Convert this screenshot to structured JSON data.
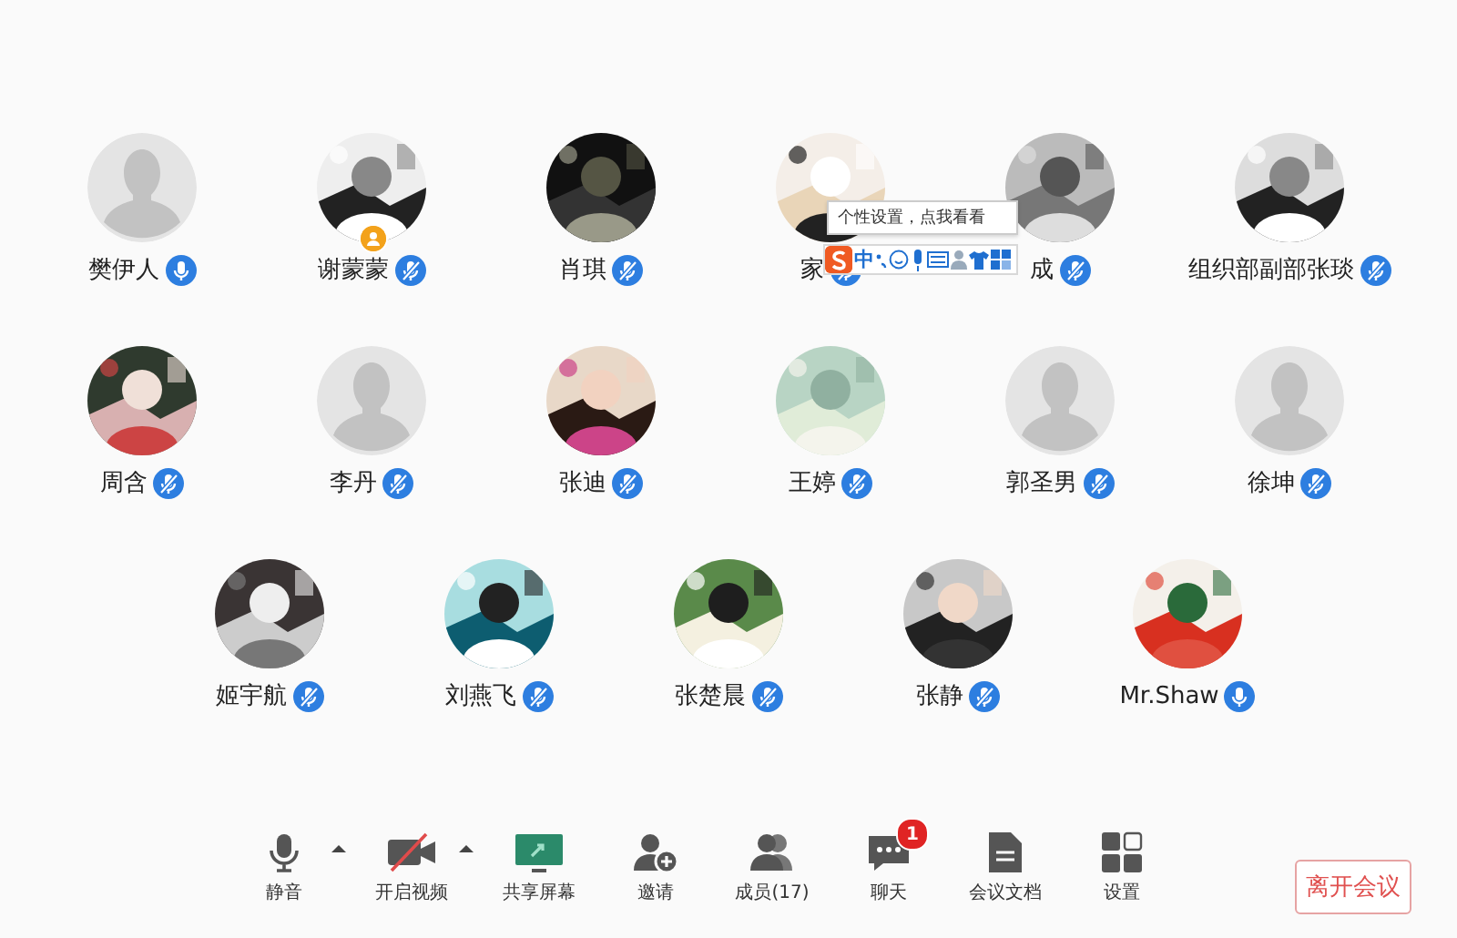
{
  "participants": [
    {
      "name": "樊伊人",
      "kind": "default",
      "muted": false,
      "host": false
    },
    {
      "name": "谢蒙蒙",
      "muted": true,
      "host": true
    },
    {
      "name": "肖琪",
      "muted": true,
      "host": false
    },
    {
      "name": "家",
      "muted": true,
      "host": false
    },
    {
      "name": "成",
      "muted": true,
      "host": false
    },
    {
      "name": "组织部副部张琰",
      "muted": true,
      "host": false
    },
    {
      "name": "周含",
      "muted": true,
      "host": false
    },
    {
      "name": "李丹",
      "kind": "default",
      "muted": true,
      "host": false
    },
    {
      "name": "张迪",
      "muted": true,
      "host": false
    },
    {
      "name": "王婷",
      "muted": true,
      "host": false
    },
    {
      "name": "郭圣男",
      "kind": "default",
      "muted": true,
      "host": false
    },
    {
      "name": "徐坤",
      "kind": "default",
      "muted": true,
      "host": false
    },
    {
      "name": "姬宇航",
      "muted": true,
      "host": false
    },
    {
      "name": "刘燕飞",
      "muted": true,
      "host": false
    },
    {
      "name": "张楚晨",
      "muted": true,
      "host": false
    },
    {
      "name": "张静",
      "muted": true,
      "host": false
    },
    {
      "name": "Mr.Shaw",
      "muted": false,
      "host": false
    }
  ],
  "ime": {
    "tooltip": "个性设置，点我看看",
    "mode": "中"
  },
  "toolbar": [
    {
      "kind": "mic",
      "label": "静音",
      "menu": true
    },
    {
      "kind": "video",
      "label": "开启视频",
      "menu": true,
      "off": true
    },
    {
      "kind": "share",
      "label": "共享屏幕",
      "menu": false
    },
    {
      "kind": "invite",
      "label": "邀请",
      "menu": false
    },
    {
      "kind": "members",
      "label": "成员(17)",
      "menu": false
    },
    {
      "kind": "chat",
      "label": "聊天",
      "menu": false,
      "badge": "1"
    },
    {
      "kind": "docs",
      "label": "会议文档",
      "menu": false
    },
    {
      "kind": "settings",
      "label": "设置",
      "menu": false
    }
  ],
  "leave_button": "离开会议"
}
